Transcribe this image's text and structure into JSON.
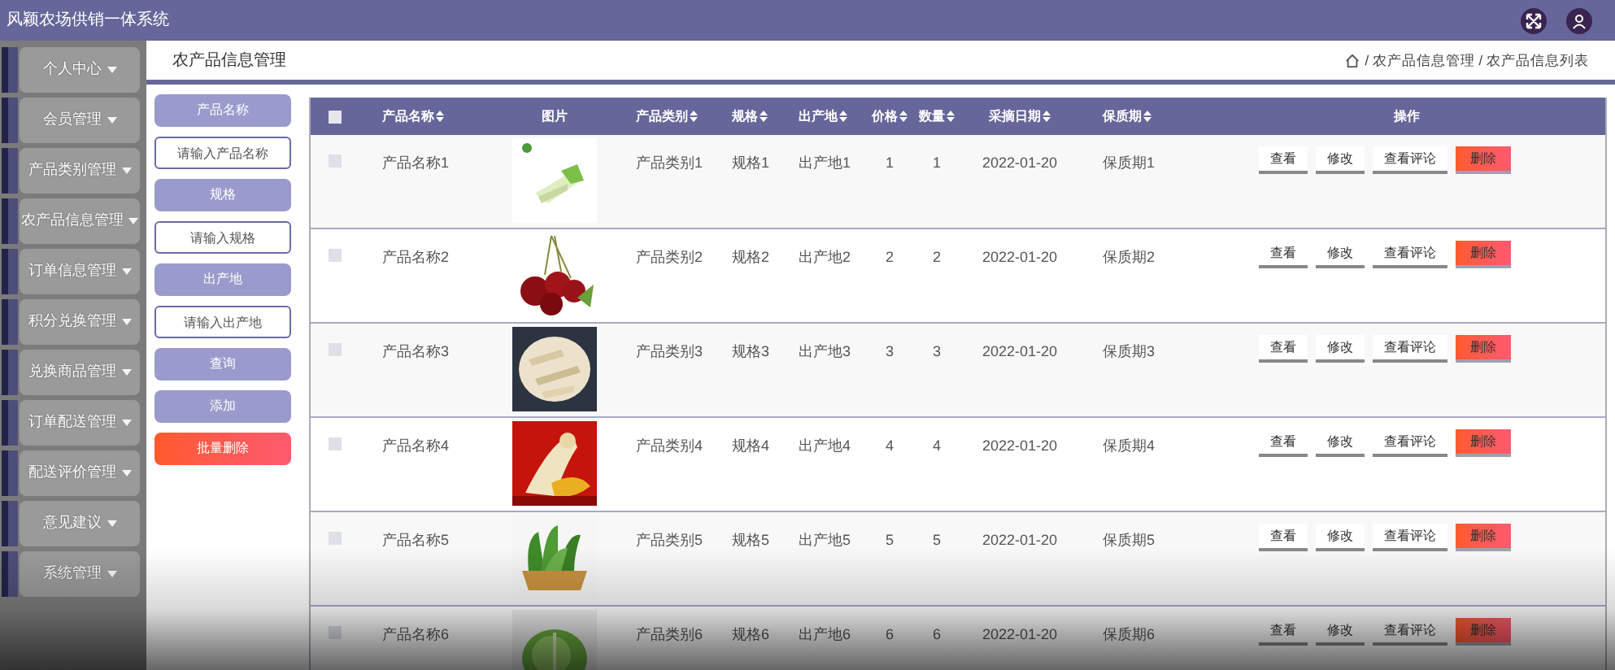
{
  "app_title": "风颖农场供销一体系统",
  "sidebar": {
    "items": [
      {
        "label": "个人中心"
      },
      {
        "label": "会员管理"
      },
      {
        "label": "产品类别管理"
      },
      {
        "label": "农产品信息管理"
      },
      {
        "label": "订单信息管理"
      },
      {
        "label": "积分兑换管理"
      },
      {
        "label": "兑换商品管理"
      },
      {
        "label": "订单配送管理"
      },
      {
        "label": "配送评价管理"
      },
      {
        "label": "意见建议"
      },
      {
        "label": "系统管理"
      }
    ]
  },
  "page_title": "农产品信息管理",
  "breadcrumb": [
    "/ 农产品信息管理 / 农产品信息列表"
  ],
  "search_panel": [
    {
      "kind": "label",
      "text": "产品名称"
    },
    {
      "kind": "input",
      "placeholder": "请输入产品名称"
    },
    {
      "kind": "label",
      "text": "规格"
    },
    {
      "kind": "input",
      "placeholder": "请输入规格"
    },
    {
      "kind": "label",
      "text": "出产地"
    },
    {
      "kind": "input",
      "placeholder": "请输入出产地"
    },
    {
      "kind": "button",
      "text": "查询"
    },
    {
      "kind": "button",
      "text": "添加"
    },
    {
      "kind": "danger",
      "text": "批量删除"
    }
  ],
  "table": {
    "select_all_checked": false,
    "columns": [
      {
        "label": "产品名称",
        "sortable": true
      },
      {
        "label": "图片",
        "sortable": false
      },
      {
        "label": "产品类别",
        "sortable": true
      },
      {
        "label": "规格",
        "sortable": true
      },
      {
        "label": "出产地",
        "sortable": true
      },
      {
        "label": "价格",
        "sortable": true
      },
      {
        "label": "数量",
        "sortable": true
      },
      {
        "label": "采摘日期",
        "sortable": true
      },
      {
        "label": "保质期",
        "sortable": true
      },
      {
        "label": "操作",
        "sortable": false
      }
    ],
    "rows": [
      {
        "checked": false,
        "name": "产品名称1",
        "category": "产品类别1",
        "spec": "规格1",
        "origin": "出产地1",
        "price": "1",
        "quantity": "1",
        "date": "2022-01-20",
        "shelf_life": "保质期1",
        "actions": [
          {
            "kind": "plain",
            "label": "查看"
          },
          {
            "kind": "plain",
            "label": "修改"
          },
          {
            "kind": "plain",
            "label": "查看评论"
          },
          {
            "kind": "danger",
            "label": "删除"
          }
        ]
      },
      {
        "checked": false,
        "name": "产品名称2",
        "category": "产品类别2",
        "spec": "规格2",
        "origin": "出产地2",
        "price": "2",
        "quantity": "2",
        "date": "2022-01-20",
        "shelf_life": "保质期2",
        "actions": [
          {
            "kind": "plain",
            "label": "查看"
          },
          {
            "kind": "plain",
            "label": "修改"
          },
          {
            "kind": "plain",
            "label": "查看评论"
          },
          {
            "kind": "danger",
            "label": "删除"
          }
        ]
      },
      {
        "checked": false,
        "name": "产品名称3",
        "category": "产品类别3",
        "spec": "规格3",
        "origin": "出产地3",
        "price": "3",
        "quantity": "3",
        "date": "2022-01-20",
        "shelf_life": "保质期3",
        "actions": [
          {
            "kind": "plain",
            "label": "查看"
          },
          {
            "kind": "plain",
            "label": "修改"
          },
          {
            "kind": "plain",
            "label": "查看评论"
          },
          {
            "kind": "danger",
            "label": "删除"
          }
        ]
      },
      {
        "checked": false,
        "name": "产品名称4",
        "category": "产品类别4",
        "spec": "规格4",
        "origin": "出产地4",
        "price": "4",
        "quantity": "4",
        "date": "2022-01-20",
        "shelf_life": "保质期4",
        "actions": [
          {
            "kind": "plain",
            "label": "查看"
          },
          {
            "kind": "plain",
            "label": "修改"
          },
          {
            "kind": "plain",
            "label": "查看评论"
          },
          {
            "kind": "danger",
            "label": "删除"
          }
        ]
      },
      {
        "checked": false,
        "name": "产品名称5",
        "category": "产品类别5",
        "spec": "规格5",
        "origin": "出产地5",
        "price": "5",
        "quantity": "5",
        "date": "2022-01-20",
        "shelf_life": "保质期5",
        "actions": [
          {
            "kind": "plain",
            "label": "查看"
          },
          {
            "kind": "plain",
            "label": "修改"
          },
          {
            "kind": "plain",
            "label": "查看评论"
          },
          {
            "kind": "danger",
            "label": "删除"
          }
        ]
      },
      {
        "checked": false,
        "name": "产品名称6",
        "category": "产品类别6",
        "spec": "规格6",
        "origin": "出产地6",
        "price": "6",
        "quantity": "6",
        "date": "2022-01-20",
        "shelf_life": "保质期6",
        "actions": [
          {
            "kind": "plain",
            "label": "查看"
          },
          {
            "kind": "plain",
            "label": "修改"
          },
          {
            "kind": "plain",
            "label": "查看评论"
          },
          {
            "kind": "danger",
            "label": "删除"
          }
        ]
      }
    ]
  }
}
